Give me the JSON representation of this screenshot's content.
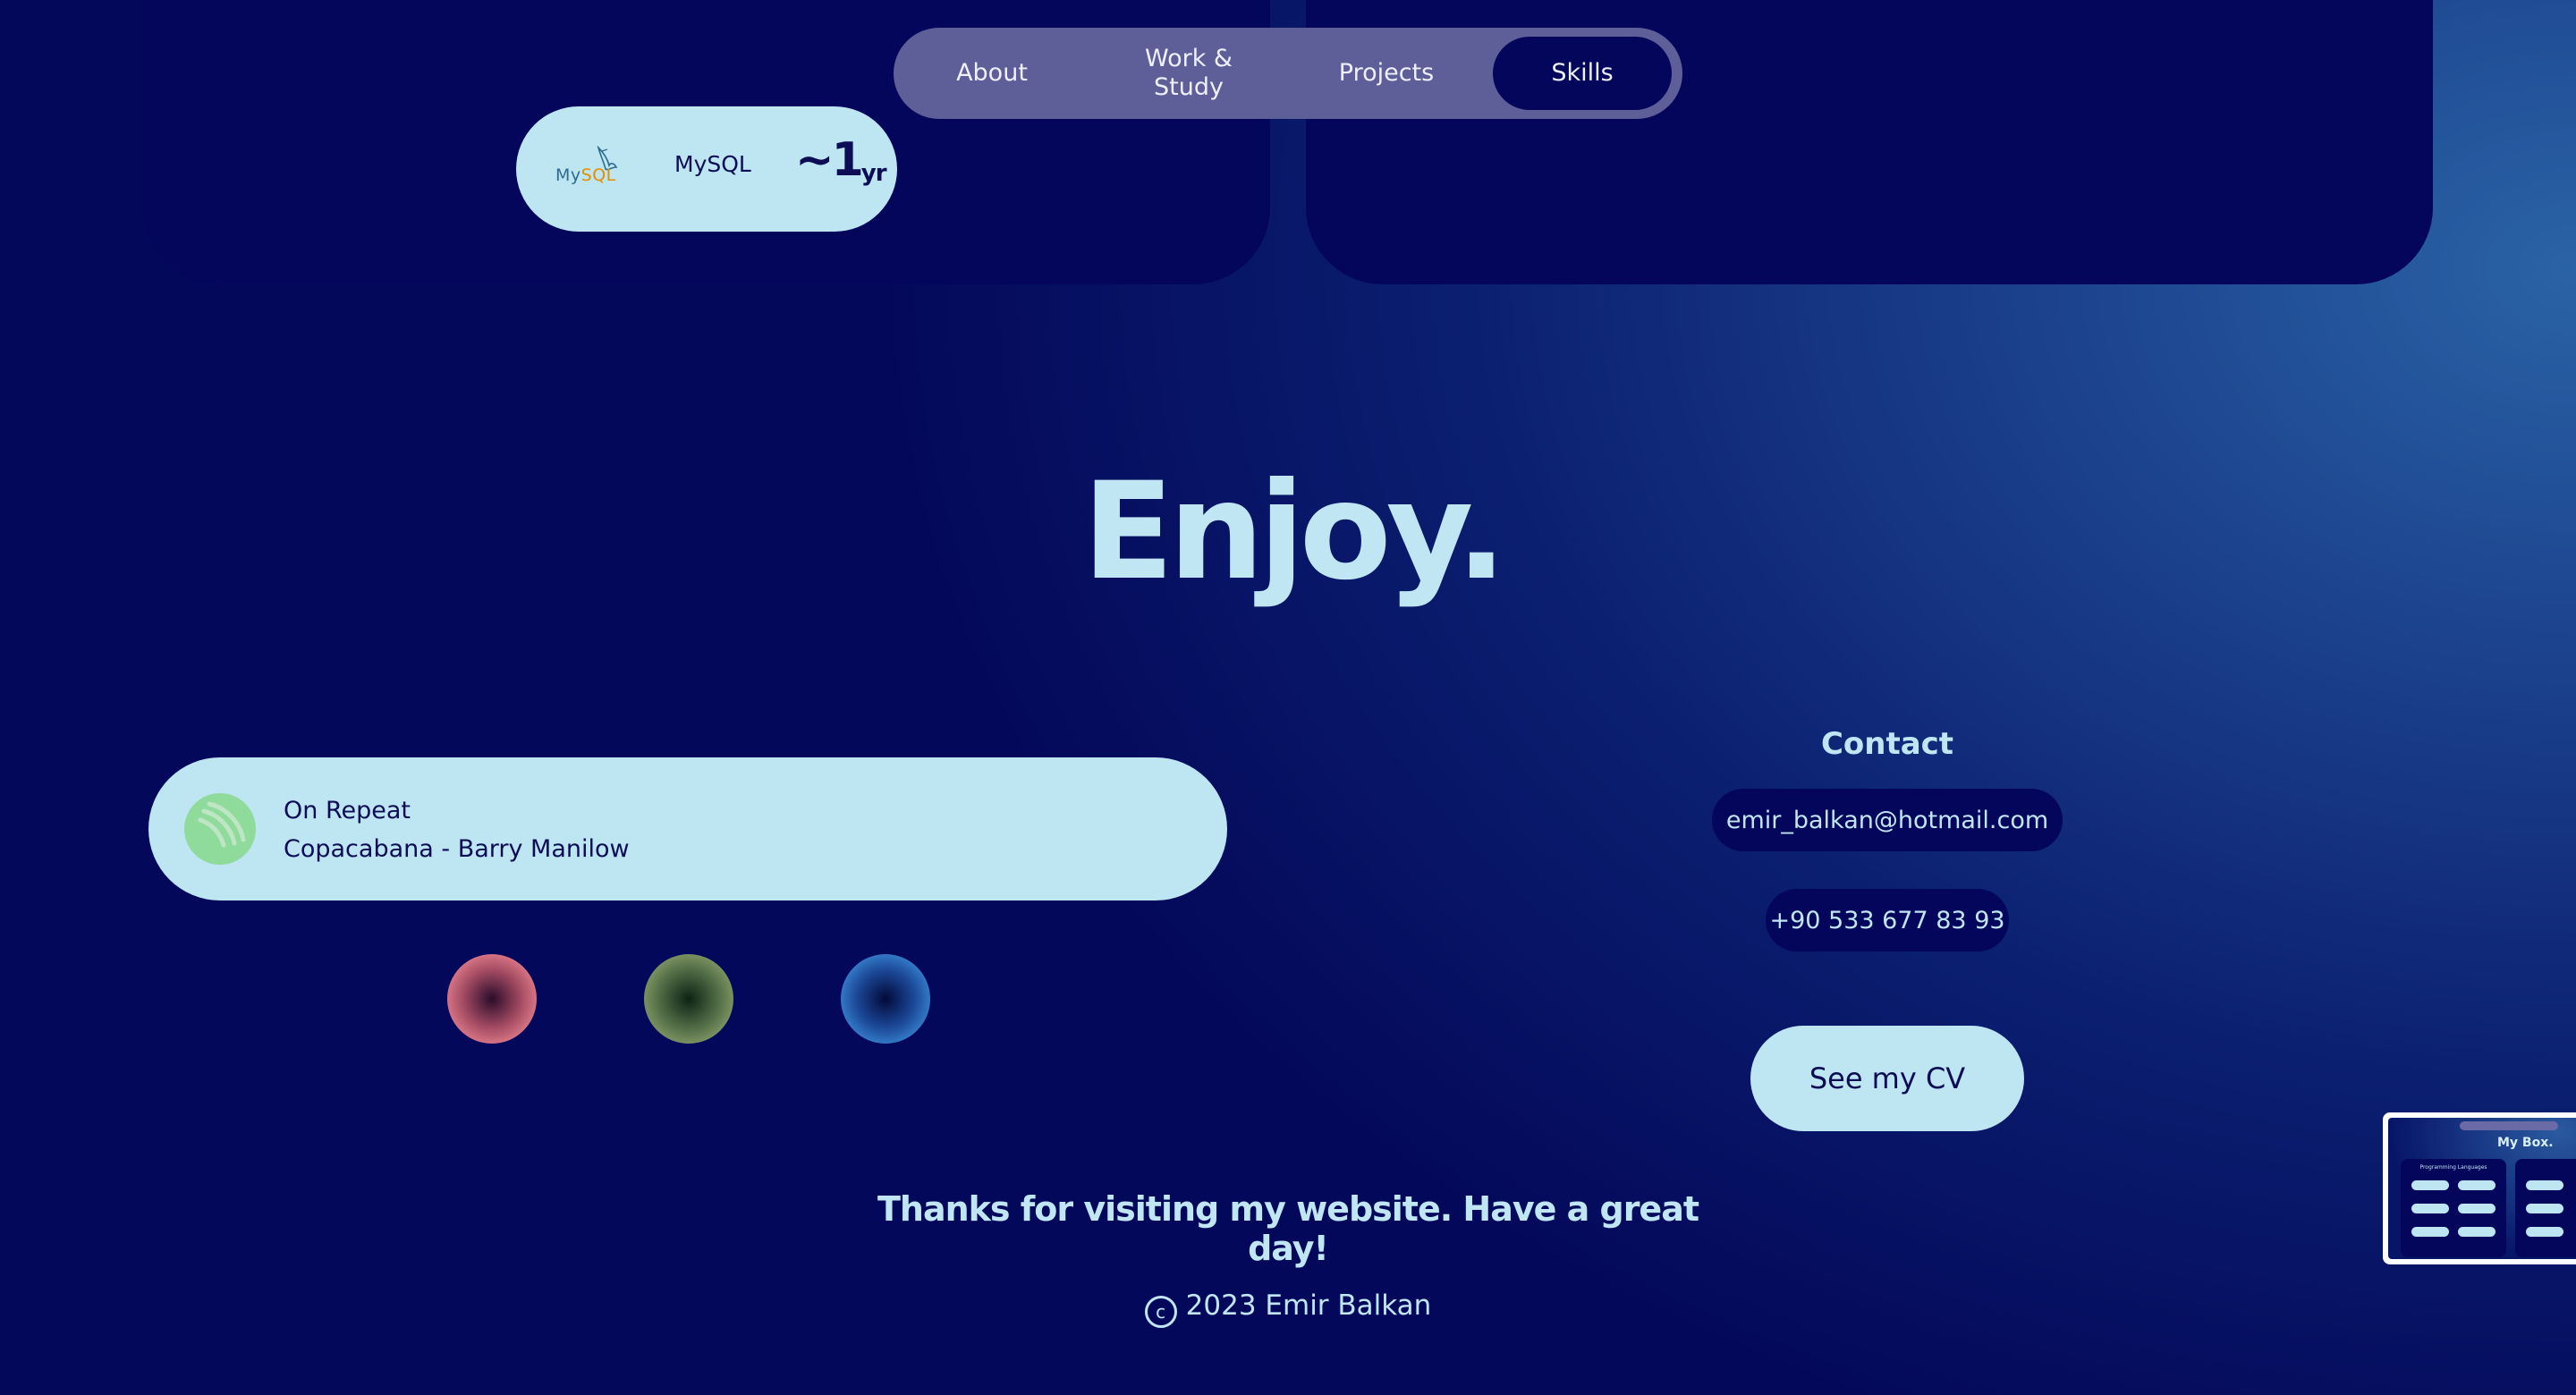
{
  "nav": {
    "items": [
      {
        "label": "About",
        "active": false
      },
      {
        "label": "Work &\nStudy",
        "active": false
      },
      {
        "label": "Projects",
        "active": false
      },
      {
        "label": "Skills",
        "active": true
      }
    ]
  },
  "skill": {
    "logo_text_a": "My",
    "logo_text_b": "SQL",
    "name": "MySQL",
    "years_value": "~1",
    "years_unit": "yr"
  },
  "hero": {
    "title": "Enjoy."
  },
  "now_playing": {
    "label": "On Repeat",
    "song": "Copacabana - Barry Manilow",
    "icon": "spotify-icon",
    "icon_color": "#8fdb9c"
  },
  "theme_orbs": [
    {
      "name": "pink",
      "color": "#e8828f"
    },
    {
      "name": "green",
      "color": "#8a9e6a"
    },
    {
      "name": "blue",
      "color": "#3a8ad6"
    }
  ],
  "contact": {
    "title": "Contact",
    "email": "emir_balkan@hotmail.com",
    "phone": "+90 533 677 83 93",
    "cv_label": "See my CV"
  },
  "footer": {
    "thanks": "Thanks for visiting my website. Have a great day!",
    "copyright_symbol": "c",
    "copyright": "2023 Emir Balkan"
  },
  "preview": {
    "title": "My Box.",
    "card_header": "Programming Languages"
  },
  "colors": {
    "accent_light": "#bee5f2",
    "navy": "#03065a",
    "nav_bg": "#5e5e98"
  }
}
